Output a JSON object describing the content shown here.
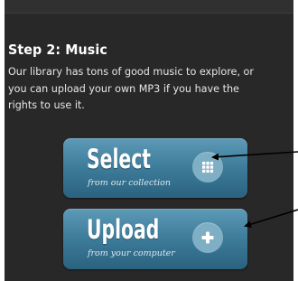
{
  "step": {
    "title": "Step 2: Music",
    "description_lines": [
      "Our library has tons of good music to explore, or",
      "you can upload your own MP3 if you have the",
      "rights to use it."
    ]
  },
  "buttons": [
    {
      "label": "Select",
      "sublabel": "from our collection",
      "icon": "grid-icon"
    },
    {
      "label": "Upload",
      "sublabel": "from your computer",
      "icon": "plus-icon"
    }
  ],
  "colors": {
    "panel_background": "#282828",
    "button_blue": "#3f7e9d",
    "icon_circle": "#7fafc5",
    "annotation_arrow": "#000000"
  }
}
